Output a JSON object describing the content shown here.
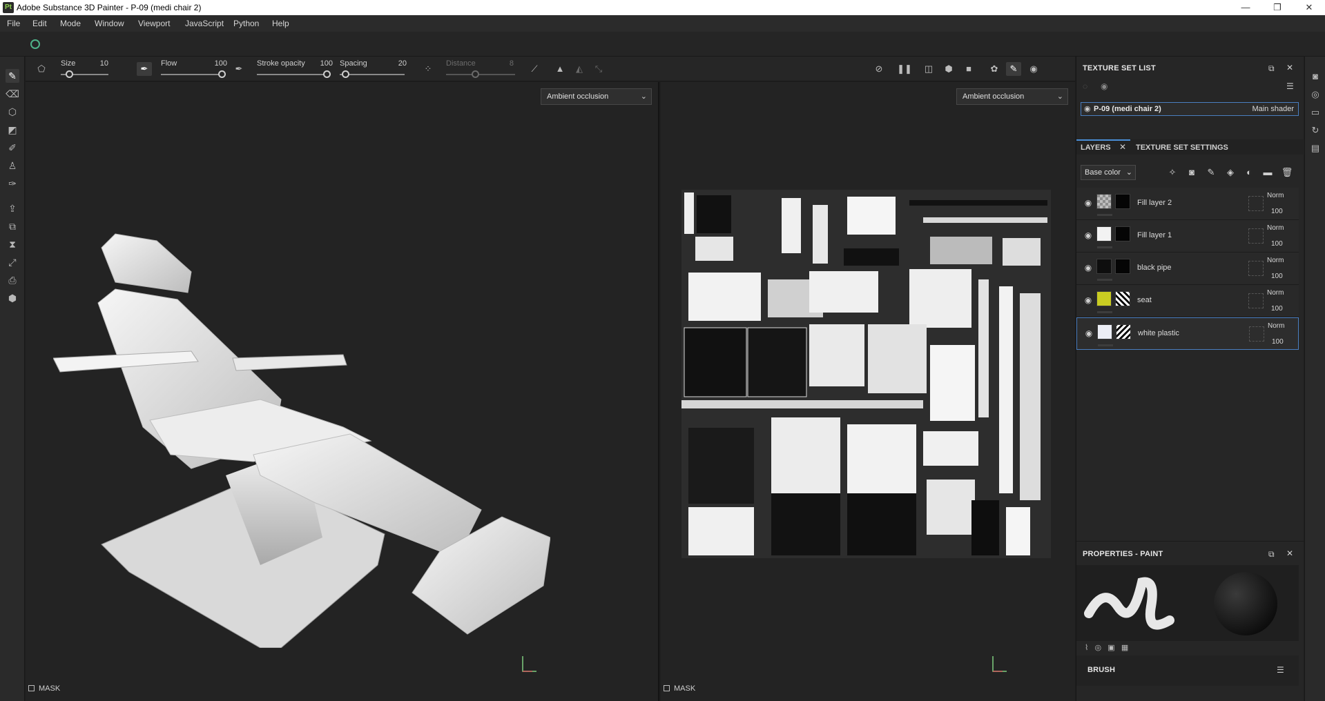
{
  "window": {
    "app_icon_text": "Pt",
    "title": "Adobe Substance 3D Painter - P-09 (medi chair 2)",
    "minimize": "—",
    "maximize": "❐",
    "close": "✕"
  },
  "menu": [
    "File",
    "Edit",
    "Mode",
    "Window",
    "Viewport",
    "JavaScript",
    "Python",
    "Help"
  ],
  "tool_options": {
    "size_label": "Size",
    "size_value": "10",
    "flow_label": "Flow",
    "flow_value": "100",
    "stroke_opacity_label": "Stroke opacity",
    "stroke_opacity_value": "100",
    "spacing_label": "Spacing",
    "spacing_value": "20",
    "distance_label": "Distance",
    "distance_value": "8",
    "sliders": {
      "size": 0.1,
      "flow": 1.0,
      "stroke_opacity": 1.0,
      "spacing": 0.02,
      "distance": 0.45
    }
  },
  "viewport3d": {
    "channel": "Ambient occlusion",
    "mask_label": "MASK"
  },
  "viewport2d": {
    "channel": "Ambient occlusion",
    "mask_label": "MASK"
  },
  "texture_set_list": {
    "title": "TEXTURE SET LIST",
    "set_name": "P-09 (medi chair 2)",
    "shader": "Main shader"
  },
  "layers_panel": {
    "tab_layers": "LAYERS",
    "tab_settings": "TEXTURE SET SETTINGS",
    "channel": "Base color",
    "layers": [
      {
        "name": "Fill layer 2",
        "blend": "Norm",
        "opacity": "100",
        "color": "#bdbdbd"
      },
      {
        "name": "Fill layer 1",
        "blend": "Norm",
        "opacity": "100",
        "color": "#f2f2f2"
      },
      {
        "name": "black pipe",
        "blend": "Norm",
        "opacity": "100",
        "color": "#0e0e0e"
      },
      {
        "name": "seat",
        "blend": "Norm",
        "opacity": "100",
        "color": "#c9cc22"
      },
      {
        "name": "white plastic",
        "blend": "Norm",
        "opacity": "100",
        "color": "#eceef6"
      }
    ]
  },
  "properties": {
    "title": "PROPERTIES - PAINT",
    "brush_label": "BRUSH"
  },
  "colors": {
    "accent": "#4a8fd8",
    "selection_border": "#4a7fc1"
  }
}
